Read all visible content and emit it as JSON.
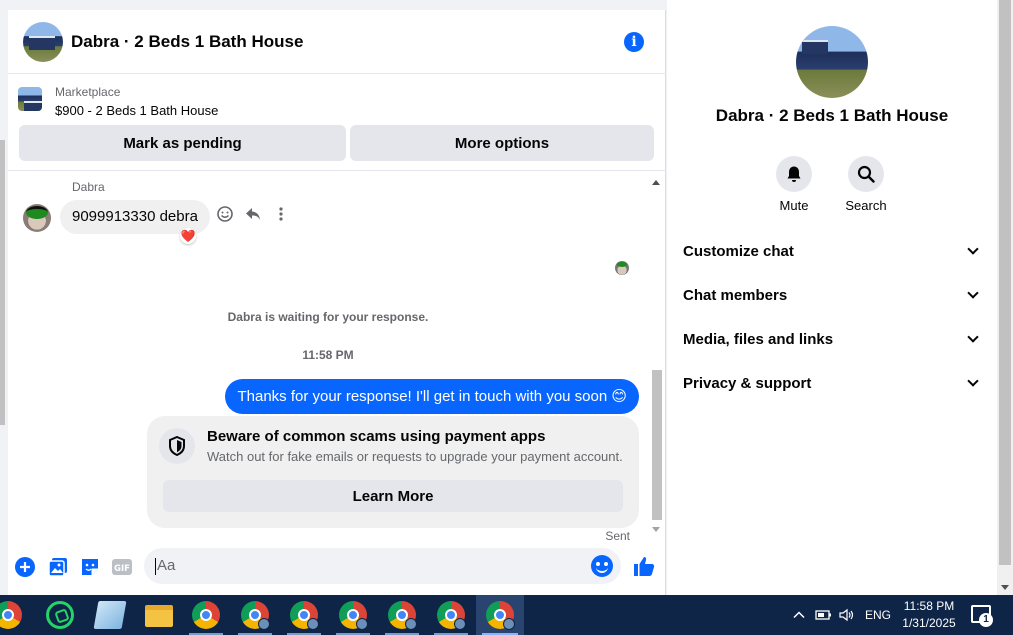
{
  "chat": {
    "title": "Dabra · 2 Beds 1 Bath House",
    "info_icon": "info-icon"
  },
  "marketplace": {
    "label": "Marketplace",
    "listing": "$900 - 2 Beds 1 Bath House",
    "mark_pending_label": "Mark as pending",
    "more_options_label": "More options"
  },
  "messages": {
    "sender_name": "Dabra",
    "incoming_text": "9099913330 debra",
    "reaction": "❤️",
    "waiting_text": "Dabra is waiting for your response.",
    "timestamp": "11:58 PM",
    "outgoing_text": "Thanks for your response! I'll get in touch with you soon 😊",
    "status": "Sent"
  },
  "scam_notice": {
    "title": "Beware of common scams using payment apps",
    "description": "Watch out for fake emails or requests to upgrade your payment account.",
    "button_label": "Learn More"
  },
  "composer": {
    "placeholder": "Aa"
  },
  "panel": {
    "title": "Dabra · 2 Beds 1 Bath House",
    "mute_label": "Mute",
    "search_label": "Search",
    "sections": [
      "Customize chat",
      "Chat members",
      "Media, files and links",
      "Privacy & support"
    ]
  },
  "taskbar": {
    "language": "ENG",
    "time": "11:58 PM",
    "date": "1/31/2025",
    "notification_count": "1"
  },
  "colors": {
    "accent": "#0866ff",
    "bubble_in": "#f0f0f0",
    "taskbar": "#0e2547"
  }
}
